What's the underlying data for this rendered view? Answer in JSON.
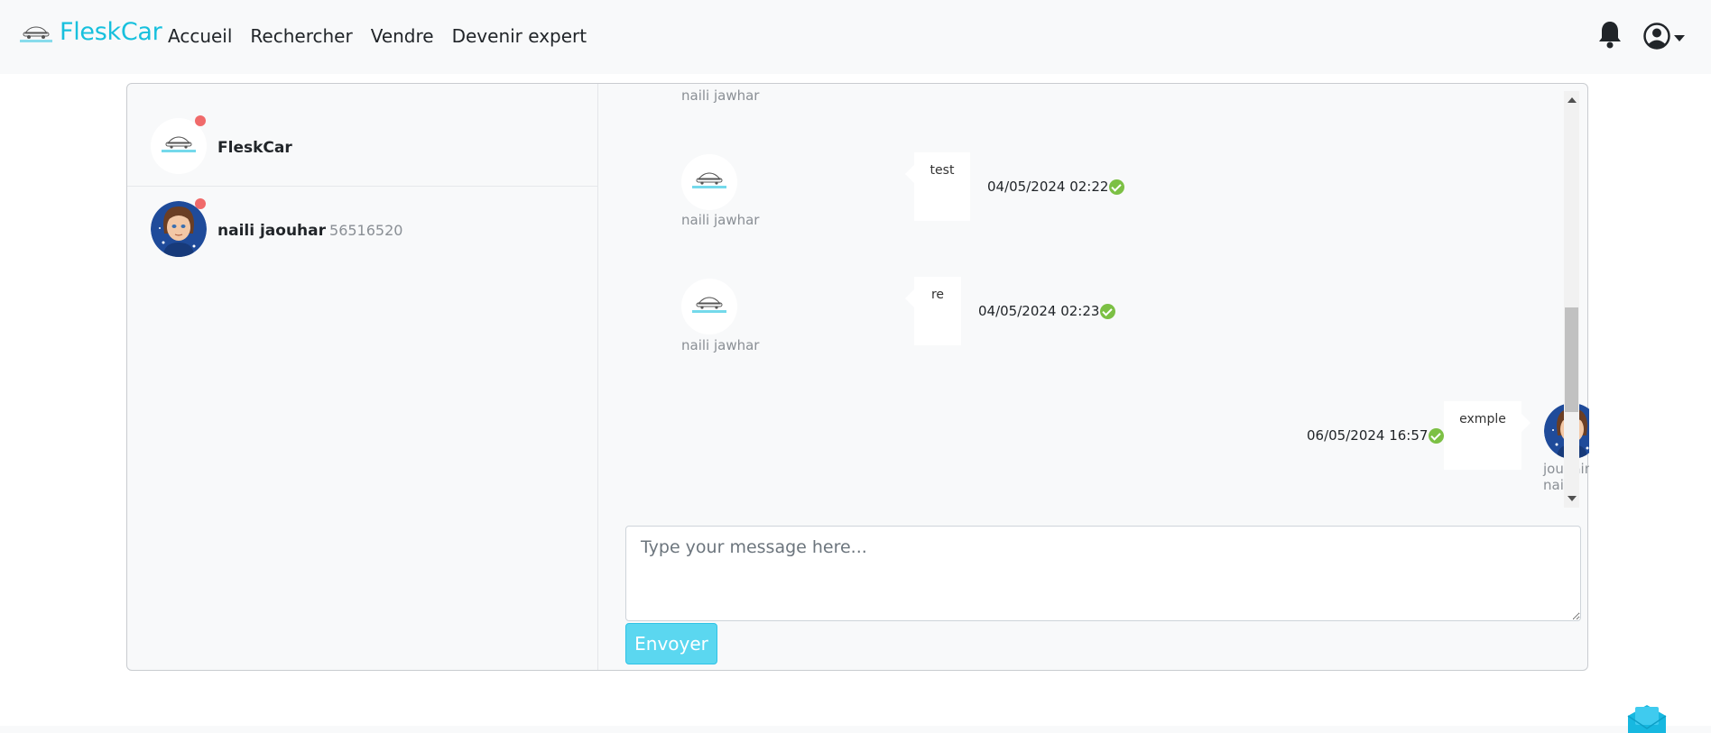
{
  "nav": {
    "brand": "FleskCar",
    "links": [
      "Accueil",
      "Rechercher",
      "Vendre",
      "Devenir expert"
    ],
    "icons": {
      "notifications": "bell-icon",
      "account": "user-circle-icon",
      "account_caret": "caret-down-icon"
    }
  },
  "conversations": [
    {
      "name": "FleskCar",
      "phone": "",
      "unread": true
    },
    {
      "name": "naili jaouhar",
      "phone": "56516520",
      "unread": true
    }
  ],
  "messages": [
    {
      "author": "naili jawhar",
      "text": "",
      "time": "",
      "partial": true
    },
    {
      "author": "naili jawhar",
      "text": "test",
      "time": "04/05/2024 02:22",
      "side": "left",
      "status": "read"
    },
    {
      "author": "naili jawhar",
      "text": "re",
      "time": "04/05/2024 02:23",
      "side": "left",
      "status": "read"
    },
    {
      "author": "jouhain naili",
      "text": "exmple",
      "time": "06/05/2024 16:57",
      "side": "right",
      "status": "read"
    }
  ],
  "composer": {
    "placeholder": "Type your message here...",
    "send_label": "Envoyer"
  },
  "colors": {
    "brand": "#17c0dd",
    "send_button": "#5bd7f0",
    "unread_dot": "#f06a6a",
    "read_check": "#7cc044"
  }
}
